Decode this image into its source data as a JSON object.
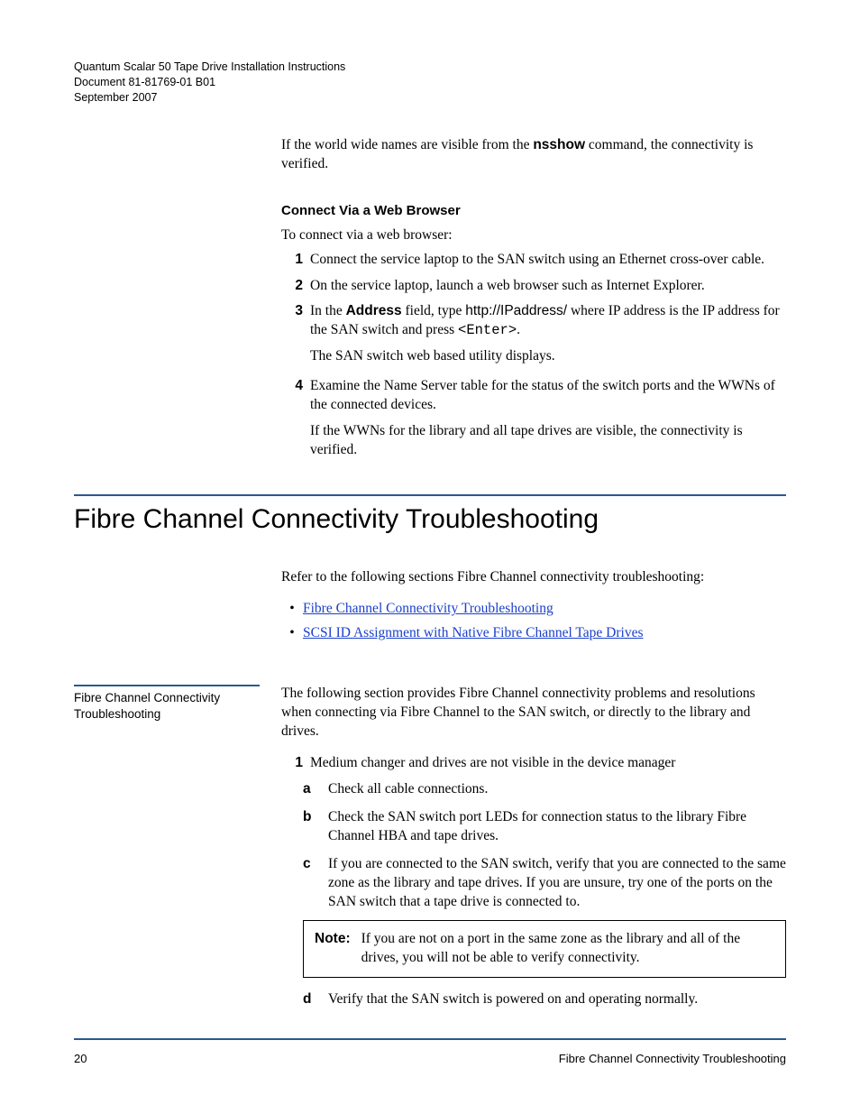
{
  "header": {
    "line1": "Quantum Scalar 50 Tape Drive Installation Instructions",
    "line2": "Document 81-81769-01 B01",
    "line3": "September 2007"
  },
  "intro": {
    "wwn_para_a": "If the world wide names are visible from the ",
    "wwn_cmd": "nsshow",
    "wwn_para_b": " command, the connectivity is verified."
  },
  "web": {
    "subhead": "Connect Via a Web Browser",
    "lead": "To connect via a web browser:",
    "steps": {
      "s1": "Connect the service laptop to the SAN switch using an Ethernet cross-over cable.",
      "s2": "On the service laptop, launch a web browser such as Internet Explorer.",
      "s3a": "In the ",
      "s3_addr": "Address",
      "s3b": " field, type ",
      "s3_url": "http://IPaddress/",
      "s3c": " where IP address is the IP address for the SAN switch and press ",
      "s3_enter": "<Enter>",
      "s3d": ".",
      "s3_after": "The SAN switch web based utility displays.",
      "s4": "Examine the Name Server table for the status of the switch ports and the WWNs of the connected devices.",
      "s4_after": "If the WWNs for the library and all tape drives are visible, the connectivity is verified."
    }
  },
  "section": {
    "title": "Fibre Channel Connectivity Troubleshooting",
    "lead": "Refer to the following sections Fibre Channel connectivity troubleshooting:",
    "links": {
      "l1": "Fibre Channel Connectivity Troubleshooting",
      "l2": "SCSI ID Assignment with Native Fibre Channel Tape Drives"
    }
  },
  "sidebar": {
    "title": "Fibre Channel Connectivity Troubleshooting"
  },
  "ts": {
    "lead": "The following section provides Fibre Channel connectivity problems and resolutions when connecting via Fibre Channel to the SAN switch, or directly to the library and drives.",
    "p1": "Medium changer and drives are not visible in the device manager",
    "a": "Check all cable connections.",
    "b": "Check the SAN switch port LEDs for connection status to the library Fibre Channel HBA and tape drives.",
    "c": "If you are connected to the SAN switch, verify that you are connected to the same zone as the library and tape drives. If you are unsure, try one of the ports on the SAN switch that a tape drive is connected to.",
    "note_label": "Note:",
    "note_text": "If you are not on a port in the same zone as the library and all of the drives, you will not be able to verify connectivity.",
    "d": "Verify that the SAN switch is powered on and operating normally."
  },
  "footer": {
    "page": "20",
    "title": "Fibre Channel Connectivity Troubleshooting"
  },
  "markers": {
    "n1": "1",
    "n2": "2",
    "n3": "3",
    "n4": "4",
    "a": "a",
    "b": "b",
    "c": "c",
    "d": "d",
    "bullet": "•"
  }
}
